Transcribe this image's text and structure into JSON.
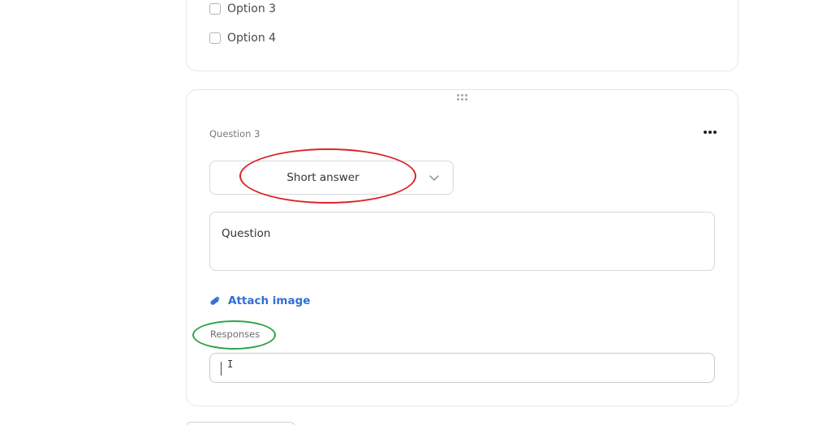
{
  "previous_question": {
    "options": [
      {
        "label": "Option 3",
        "checked": false
      },
      {
        "label": "Option 4",
        "checked": false
      }
    ]
  },
  "question3": {
    "label": "Question 3",
    "more_icon": "more-horizontal-icon",
    "type_select": {
      "value": "Short answer",
      "icon": "chevron-down-icon"
    },
    "question_field": {
      "placeholder": "Question"
    },
    "attach": {
      "label": "Attach image",
      "icon": "paperclip-icon"
    },
    "responses": {
      "label": "Responses",
      "value": ""
    }
  },
  "annotations": {
    "type_highlight_color": "#d9252b",
    "responses_highlight_color": "#2ea24a"
  },
  "colors": {
    "accent": "#2f6fd6"
  }
}
